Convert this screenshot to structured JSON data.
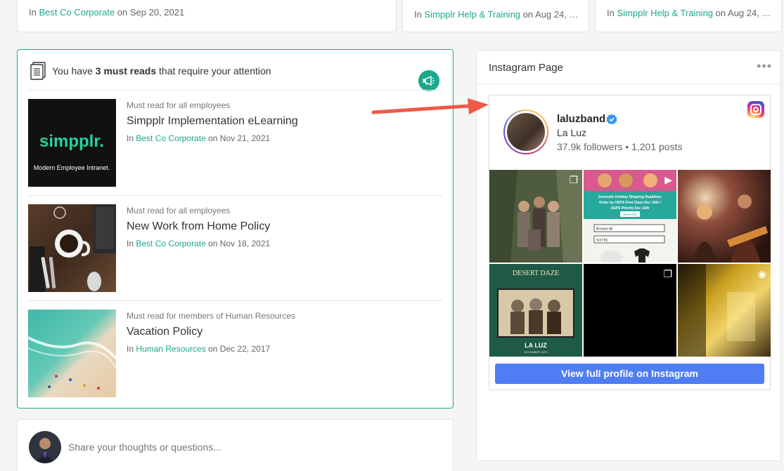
{
  "top_cards": [
    {
      "in_label": "In",
      "place": "Best Co Corporate",
      "on_label": "on",
      "date": "Sep 20, 2021"
    },
    {
      "in_label": "In",
      "place": "Simpplr Help & Training",
      "on_label": "on",
      "date": "Aug 24, 2..."
    },
    {
      "in_label": "In",
      "place": "Simpplr Help & Training",
      "on_label": "on",
      "date": "Aug 24, 2..."
    }
  ],
  "must_reads": {
    "header_prefix": "You have",
    "count_text": "3 must reads",
    "header_suffix": "that require your attention",
    "items": [
      {
        "audience": "Must read for all employees",
        "title": "Simpplr Implementation eLearning",
        "in_label": "In",
        "place": "Best Co Corporate",
        "on_label": "on",
        "date": "Nov 21, 2021",
        "thumb_brand": "simpplr.",
        "thumb_tagline": "Modern Employee Intranet."
      },
      {
        "audience": "Must read for all employees",
        "title": "New Work from Home Policy",
        "in_label": "In",
        "place": "Best Co Corporate",
        "on_label": "on",
        "date": "Nov 18, 2021"
      },
      {
        "audience": "Must read for members of Human Resources",
        "title": "Vacation Policy",
        "in_label": "In",
        "place": "Human Resources",
        "on_label": "on",
        "date": "Dec 22, 2017"
      }
    ]
  },
  "composer": {
    "placeholder": "Share your thoughts or questions..."
  },
  "instagram": {
    "panel_title": "Instagram Page",
    "more_glyph": "•••",
    "username": "laluzband",
    "display_name": "La Luz",
    "followers": "37.9k followers",
    "separator": "•",
    "posts": "1,201 posts",
    "view_button": "View full profile on Instagram",
    "promo_lines": [
      "Domestic Holiday Shipping Deadlines",
      "Order by USPS First Class Dec 14th /",
      "USPS Priority Dec 16th"
    ],
    "promo_more": "More Info",
    "promo_fields": [
      "Browse All",
      "Sort By"
    ],
    "poster_title": "DESERT DAZE",
    "poster_band": "LA LUZ",
    "poster_date": "DECEMBER 14TH"
  },
  "colors": {
    "accent": "#1aa88c",
    "instagram_button": "#4f7df3",
    "annotation_arrow": "#f0584a"
  }
}
